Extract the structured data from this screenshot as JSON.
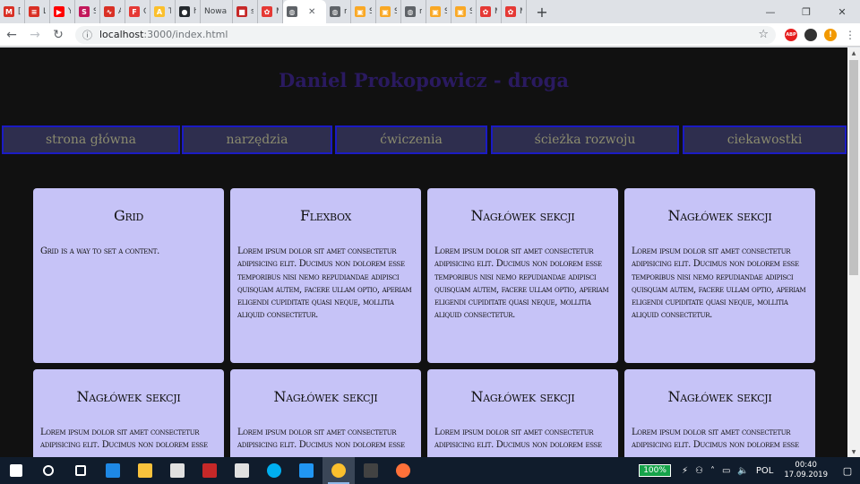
{
  "browser": {
    "tabs": [
      {
        "label": "[G",
        "favicon": "gmail-icon",
        "color": "#d93025",
        "glyph": "M"
      },
      {
        "label": "Le",
        "favicon": "lines-icon",
        "color": "#d93025",
        "glyph": "≡"
      },
      {
        "label": "Yo",
        "favicon": "youtube-icon",
        "color": "#ff0000",
        "glyph": "▶"
      },
      {
        "label": "Sa",
        "favicon": "sa-icon",
        "color": "#c2185b",
        "glyph": "S"
      },
      {
        "label": "Au",
        "favicon": "wave-icon",
        "color": "#d93025",
        "glyph": "∿"
      },
      {
        "label": "Go",
        "favicon": "google-forms-icon",
        "color": "#e53935",
        "glyph": "F"
      },
      {
        "label": "To",
        "favicon": "to-icon",
        "color": "#fbc02d",
        "glyph": "A"
      },
      {
        "label": "ho",
        "favicon": "github-icon",
        "color": "#24292e",
        "glyph": "●"
      },
      {
        "label": "Nowa",
        "favicon": "none",
        "color": "",
        "glyph": ""
      },
      {
        "label": "sz",
        "favicon": "box-icon",
        "color": "#c62828",
        "glyph": "■"
      },
      {
        "label": "M·",
        "favicon": "huawei-icon",
        "color": "#e53935",
        "glyph": "✿"
      },
      {
        "label": "",
        "favicon": "globe-icon",
        "color": "#5f6368",
        "glyph": "◍",
        "active": true
      },
      {
        "label": "m",
        "favicon": "globe-icon",
        "color": "#5f6368",
        "glyph": "◍"
      },
      {
        "label": "St",
        "favicon": "sticky-icon",
        "color": "#f9a825",
        "glyph": "▣"
      },
      {
        "label": "St",
        "favicon": "sticky-icon",
        "color": "#f9a825",
        "glyph": "▣"
      },
      {
        "label": "m",
        "favicon": "globe-icon",
        "color": "#5f6368",
        "glyph": "◍"
      },
      {
        "label": "St",
        "favicon": "sticky-icon",
        "color": "#f9a825",
        "glyph": "▣"
      },
      {
        "label": "St",
        "favicon": "sticky-icon",
        "color": "#f9a825",
        "glyph": "▣"
      },
      {
        "label": "M·",
        "favicon": "huawei-icon",
        "color": "#e53935",
        "glyph": "✿"
      },
      {
        "label": "M·",
        "favicon": "huawei-icon",
        "color": "#e53935",
        "glyph": "✿"
      }
    ],
    "url_host": "localhost",
    "url_path": ":3000/index.html",
    "extensions": {
      "abp": "ABP"
    }
  },
  "page": {
    "title": "Daniel Prokopowicz - droga",
    "nav": [
      "strona główna",
      "narzędzia",
      "ćwiczenia",
      "ścieżka rozwoju",
      "ciekawostki"
    ],
    "cards": [
      {
        "title": "Grid",
        "text": "Grid is a way to set a content."
      },
      {
        "title": "Flexbox",
        "text": "Lorem ipsum dolor sit amet consectetur adipisicing elit. Ducimus non dolorem esse temporibus nisi nemo repudiandae adipisci quisquam autem, facere ullam optio, aperiam eligendi cupiditate quasi neque, mollitia aliquid consectetur."
      },
      {
        "title": "Nagłówek sekcji",
        "text": "Lorem ipsum dolor sit amet consectetur adipisicing elit. Ducimus non dolorem esse temporibus nisi nemo repudiandae adipisci quisquam autem, facere ullam optio, aperiam eligendi cupiditate quasi neque, mollitia aliquid consectetur."
      },
      {
        "title": "Nagłówek sekcji",
        "text": "Lorem ipsum dolor sit amet consectetur adipisicing elit. Ducimus non dolorem esse temporibus nisi nemo repudiandae adipisci quisquam autem, facere ullam optio, aperiam eligendi cupiditate quasi neque, mollitia aliquid consectetur."
      },
      {
        "title": "Nagłówek sekcji",
        "text": "Lorem ipsum dolor sit amet consectetur adipisicing elit. Ducimus non dolorem esse"
      },
      {
        "title": "Nagłówek sekcji",
        "text": "Lorem ipsum dolor sit amet consectetur adipisicing elit. Ducimus non dolorem esse"
      },
      {
        "title": "Nagłówek sekcji",
        "text": "Lorem ipsum dolor sit amet consectetur adipisicing elit. Ducimus non dolorem esse"
      },
      {
        "title": "Nagłówek sekcji",
        "text": "Lorem ipsum dolor sit amet consectetur adipisicing elit. Ducimus non dolorem esse"
      }
    ]
  },
  "taskbar": {
    "apps": [
      {
        "name": "windows-start-icon",
        "color": "#ffffff"
      },
      {
        "name": "search-icon",
        "color": "#ffffff"
      },
      {
        "name": "task-view-icon",
        "color": "#ffffff"
      },
      {
        "name": "edge-icon",
        "color": "#1e88e5"
      },
      {
        "name": "file-explorer-icon",
        "color": "#f9c23c"
      },
      {
        "name": "store-icon",
        "color": "#e0e0e0"
      },
      {
        "name": "mcafee-icon",
        "color": "#c62828"
      },
      {
        "name": "mail-icon",
        "color": "#e0e0e0"
      },
      {
        "name": "skype-icon",
        "color": "#00aff0"
      },
      {
        "name": "vscode-icon",
        "color": "#2196f3"
      },
      {
        "name": "chrome-icon",
        "color": "#fbc02d",
        "active": true
      },
      {
        "name": "terminal-icon",
        "color": "#424242"
      },
      {
        "name": "firefox-icon",
        "color": "#ff7139"
      }
    ],
    "battery": "100%",
    "language": "POL",
    "time": "00:40",
    "date": "17.09.2019"
  }
}
